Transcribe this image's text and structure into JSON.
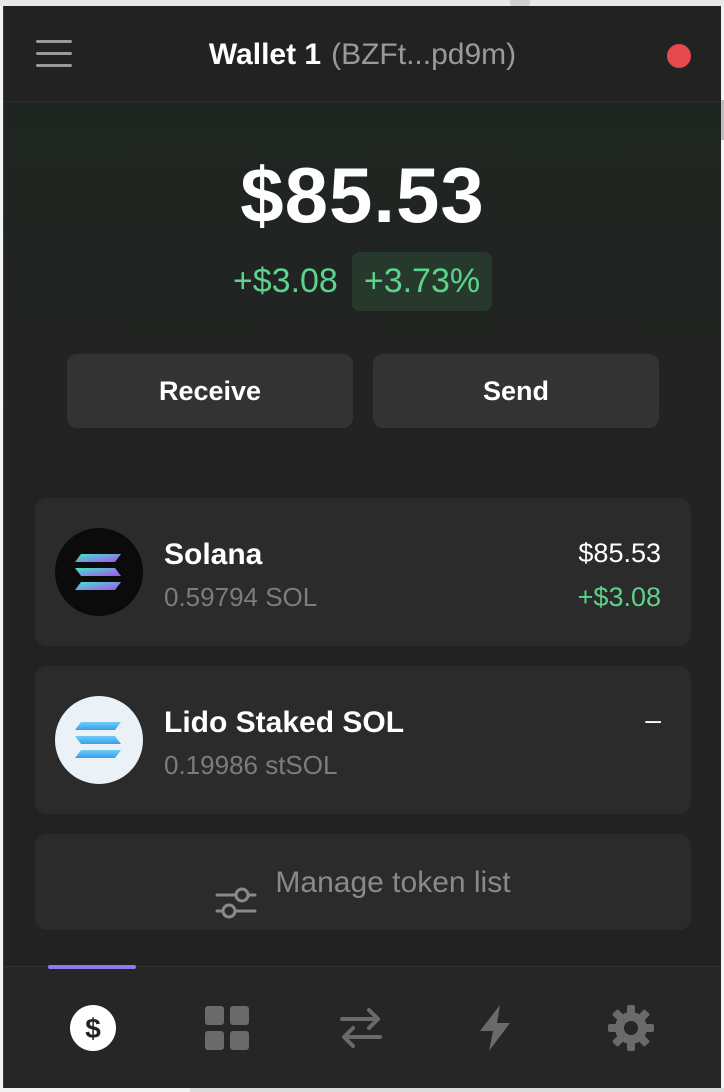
{
  "header": {
    "wallet_name": "Wallet 1",
    "wallet_address": "(BZFt...pd9m)",
    "status_color": "#e5484d"
  },
  "balance": {
    "total": "$85.53",
    "change_amount": "+$3.08",
    "change_percent": "+3.73%"
  },
  "actions": {
    "receive_label": "Receive",
    "send_label": "Send"
  },
  "tokens": [
    {
      "name": "Solana",
      "quantity": "0.59794 SOL",
      "value": "$85.53",
      "change": "+$3.08",
      "icon": "solana-logo-icon"
    },
    {
      "name": "Lido Staked SOL",
      "quantity": "0.19986 stSOL",
      "value": "–",
      "icon": "lido-stsol-logo-icon"
    }
  ],
  "manage": {
    "label": "Manage token list",
    "icon": "sliders-icon"
  },
  "nav": {
    "items": [
      "wallet-dollar-icon",
      "apps-grid-icon",
      "swap-arrows-icon",
      "bolt-icon",
      "gear-icon"
    ],
    "active_index": 0,
    "accent_color": "#8a7cf0"
  },
  "colors": {
    "positive": "#5bd38a",
    "background": "#222222",
    "card": "#2b2b2b"
  }
}
